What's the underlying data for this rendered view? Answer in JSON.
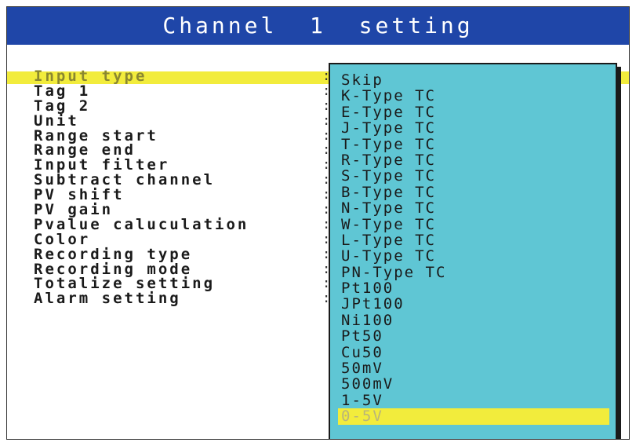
{
  "window": {
    "title": "Channel  1  setting"
  },
  "settings_menu": {
    "items": [
      {
        "label": "Input type",
        "selected": true
      },
      {
        "label": "Tag 1",
        "selected": false
      },
      {
        "label": "Tag 2",
        "selected": false
      },
      {
        "label": "Unit",
        "selected": false
      },
      {
        "label": "Range start",
        "selected": false
      },
      {
        "label": "Range end",
        "selected": false
      },
      {
        "label": "Input filter",
        "selected": false
      },
      {
        "label": "Subtract channel",
        "selected": false
      },
      {
        "label": "PV shift",
        "selected": false
      },
      {
        "label": "PV gain",
        "selected": false
      },
      {
        "label": "Pvalue caluculation",
        "selected": false
      },
      {
        "label": "Color",
        "selected": false
      },
      {
        "label": "Recording type",
        "selected": false
      },
      {
        "label": "Recording mode",
        "selected": false
      },
      {
        "label": "Totalize setting",
        "selected": false
      },
      {
        "label": "Alarm setting",
        "selected": false
      }
    ],
    "separator": ":"
  },
  "input_type_dropdown": {
    "options": [
      "Skip",
      "K-Type TC",
      "E-Type TC",
      "J-Type TC",
      "T-Type TC",
      "R-Type TC",
      "S-Type TC",
      "B-Type TC",
      "N-Type TC",
      "W-Type TC",
      "L-Type TC",
      "U-Type TC",
      "PN-Type TC",
      "Pt100",
      "JPt100",
      "Ni100",
      "Pt50",
      "Cu50",
      "50mV",
      "500mV",
      "1-5V",
      "0-5V"
    ],
    "highlighted_option": "0-5V"
  },
  "colors": {
    "title_bar": "#1f46a8",
    "highlight": "#f2ec3c",
    "dropdown_background": "#5fc6d4"
  }
}
